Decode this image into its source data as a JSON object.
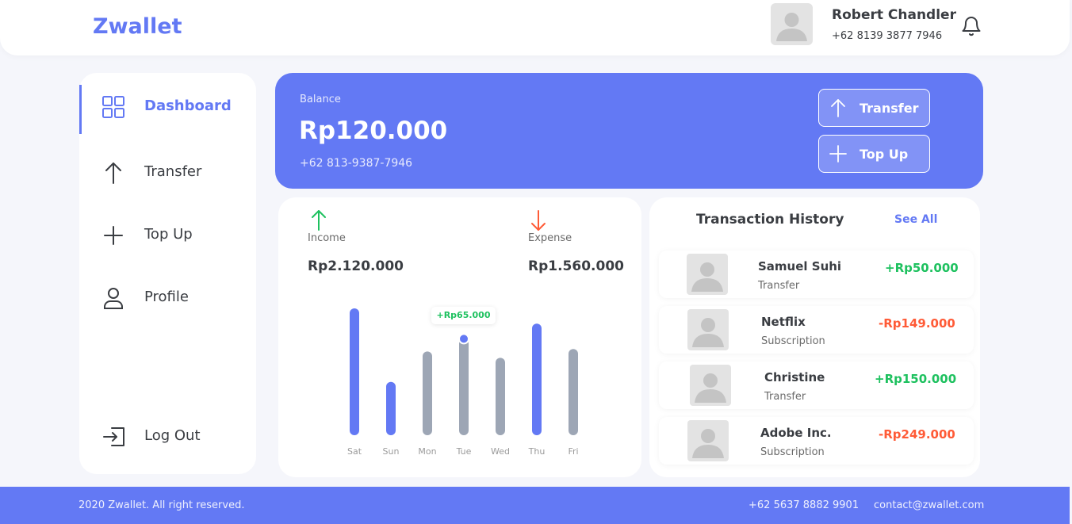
{
  "header": {
    "logo": "Zwallet",
    "user_name": "Robert Chandler",
    "user_phone": "+62 8139 3877 7946"
  },
  "sidebar": {
    "items": [
      {
        "label": "Dashboard",
        "icon": "grid-icon"
      },
      {
        "label": "Transfer",
        "icon": "arrow-up-icon"
      },
      {
        "label": "Top Up",
        "icon": "plus-icon"
      },
      {
        "label": "Profile",
        "icon": "user-icon"
      }
    ],
    "logout": "Log Out"
  },
  "balance": {
    "label": "Balance",
    "amount": "Rp120.000",
    "phone": "+62 813-9387-7946",
    "transfer_label": "Transfer",
    "topup_label": "Top Up"
  },
  "stats": {
    "income_label": "Income",
    "income_value": "Rp2.120.000",
    "expense_label": "Expense",
    "expense_value": "Rp1.560.000",
    "tooltip": "+Rp65.000"
  },
  "chart_data": {
    "type": "bar",
    "categories": [
      "Sat",
      "Sun",
      "Mon",
      "Tue",
      "Wed",
      "Thu",
      "Fri"
    ],
    "values": [
      100,
      42,
      66,
      76,
      61,
      88,
      68
    ],
    "highlighted": [
      true,
      true,
      false,
      false,
      false,
      true,
      false
    ],
    "selected_index": 3,
    "ylim": [
      0,
      100
    ]
  },
  "history": {
    "title": "Transaction History",
    "see_all": "See All",
    "items": [
      {
        "name": "Samuel Suhi",
        "type": "Transfer",
        "amount": "+Rp50.000",
        "sign": "pos"
      },
      {
        "name": "Netflix",
        "type": "Subscription",
        "amount": "-Rp149.000",
        "sign": "neg"
      },
      {
        "name": "Christine",
        "type": "Transfer",
        "amount": "+Rp150.000",
        "sign": "pos"
      },
      {
        "name": "Adobe Inc.",
        "type": "Subscription",
        "amount": "-Rp249.000",
        "sign": "neg"
      }
    ]
  },
  "footer": {
    "copyright": "2020 Zwallet. All right reserved.",
    "phone": "+62 5637 8882 9901",
    "email": "contact@zwallet.com"
  },
  "colors": {
    "primary": "#6379f4",
    "income": "#1ec15f",
    "expense": "#ff5b37",
    "bar_inactive": "#9da6b5"
  }
}
